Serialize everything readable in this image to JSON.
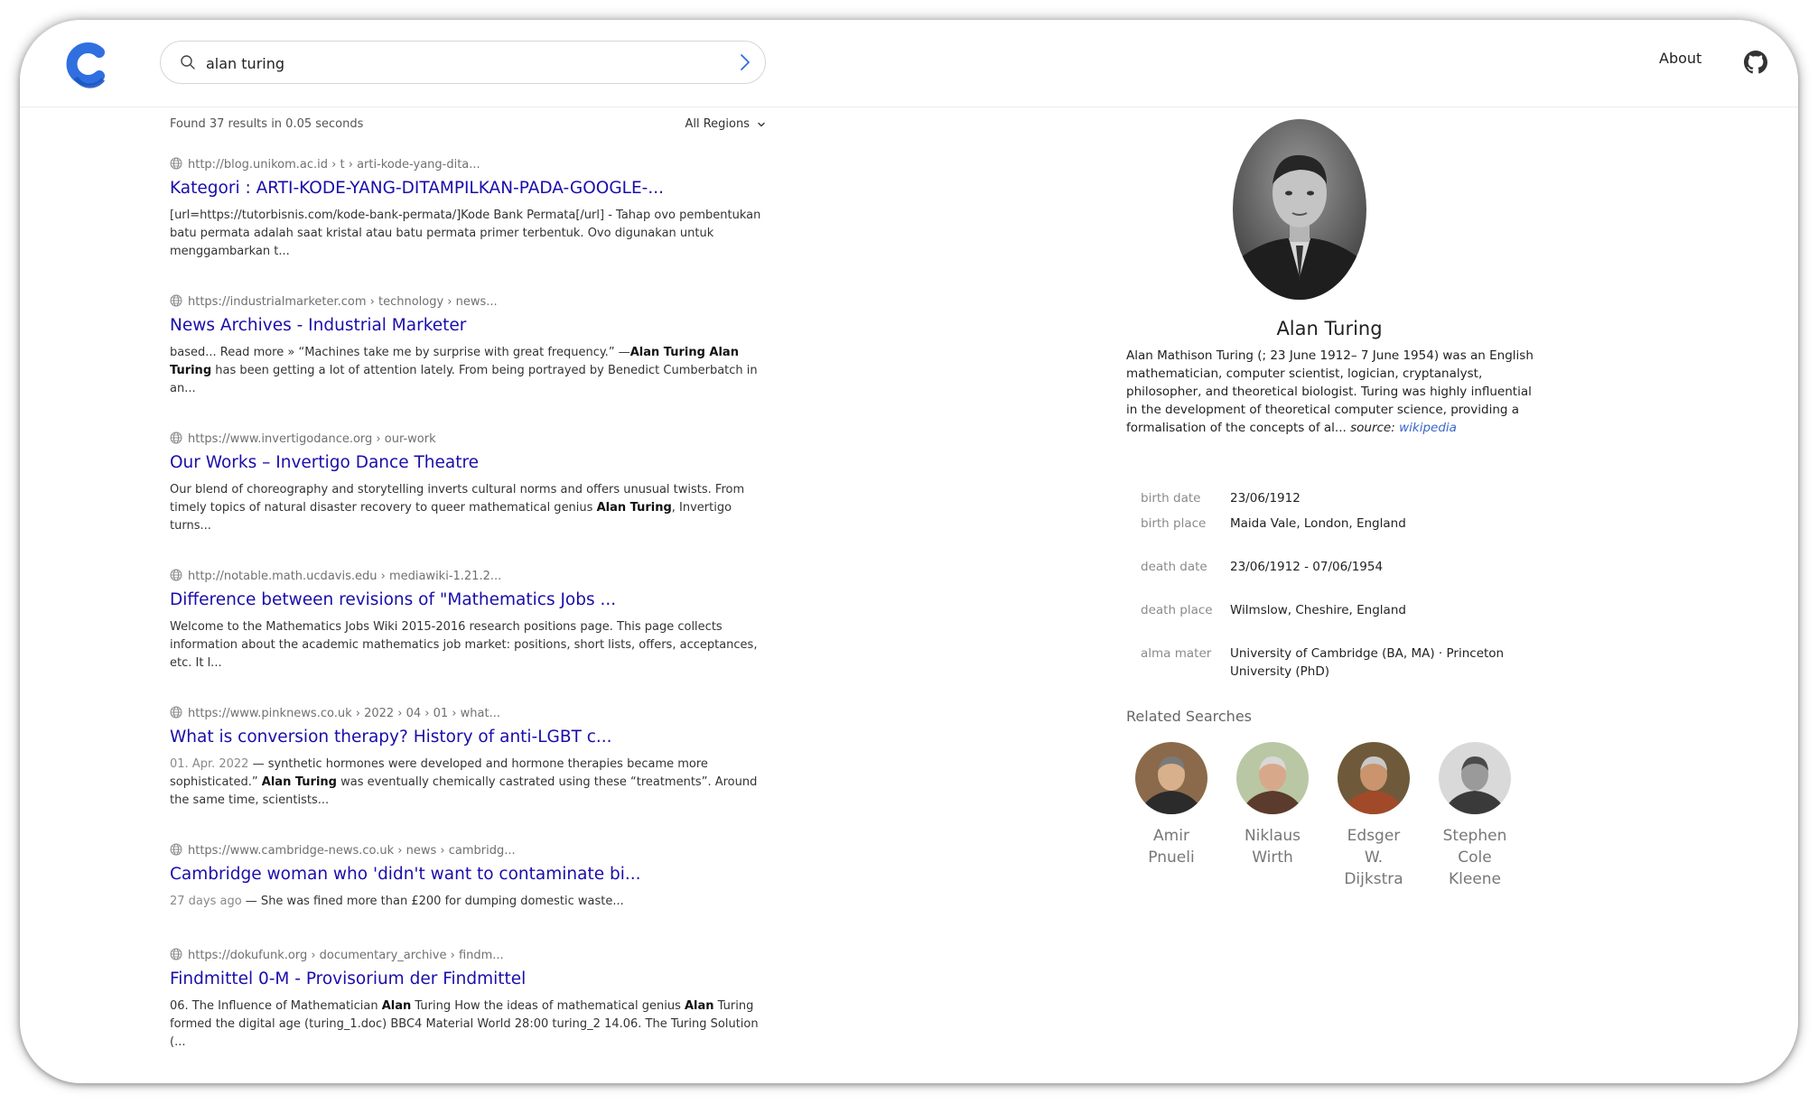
{
  "search": {
    "query": "alan turing"
  },
  "header": {
    "about_label": "About"
  },
  "meta": {
    "results_count": "Found 37 results in 0.05 seconds",
    "region": "All Regions"
  },
  "results": [
    {
      "url": "http://blog.unikom.ac.id › t › arti-kode-yang-dita...",
      "title": "Kategori : ARTI-KODE-YANG-DITAMPILKAN-PADA-GOOGLE-...",
      "snippet_html": "[url=https://tutorbisnis.com/kode-bank-permata/]Kode Bank Permata[/url] - Tahap ovo pembentukan batu permata adalah saat kristal atau batu permata primer terbentuk. Ovo digunakan untuk menggambarkan t..."
    },
    {
      "url": "https://industrialmarketer.com › technology › news...",
      "title": "News Archives - Industrial Marketer",
      "snippet_html": "based... Read more » “Machines take me by surprise with great frequency.” —<b>Alan Turing Alan Turing</b> has been getting a lot of attention lately. From being portrayed by Benedict Cumberbatch in an..."
    },
    {
      "url": "https://www.invertigodance.org › our-work",
      "title": "Our Works – Invertigo Dance Theatre",
      "snippet_html": "Our blend of choreography and storytelling inverts cultural norms and offers unusual twists. From timely topics of natural disaster recovery to queer mathematical genius <b>Alan Turing</b>, Invertigo turns..."
    },
    {
      "url": "http://notable.math.ucdavis.edu › mediawiki-1.21.2...",
      "title": "Difference between revisions of \"Mathematics Jobs ...",
      "snippet_html": "Welcome to the Mathematics Jobs Wiki 2015-2016 research positions page. This page collects information about the academic mathematics job market: positions, short lists, offers, acceptances, etc. It l..."
    },
    {
      "url": "https://www.pinknews.co.uk › 2022 › 04 › 01 › what...",
      "title": "What is conversion therapy? History of anti-LGBT c...",
      "snippet_html": "<span class=\"date\">01. Apr. 2022</span> — synthetic hormones were developed and hormone therapies became more sophisticated.” <b>Alan Turing</b> was eventually chemically castrated using these “treatments”. Around the same time, scientists..."
    },
    {
      "url": "https://www.cambridge-news.co.uk › news › cambridg...",
      "title": "Cambridge woman who 'didn't want to contaminate bi...",
      "snippet_html": "<span class=\"date\">27 days ago</span> — She was fined more than £200 for dumping domestic waste..."
    },
    {
      "url": "https://dokufunk.org › documentary_archive › findm...",
      "title": "Findmittel 0-M - Provisorium der Findmittel",
      "snippet_html": "06. The Influence of Mathematician <b>Alan</b> Turing How the ideas of mathematical genius <b>Alan</b> Turing formed the digital age (turing_1.doc) BBC4 Material World 28:00 turing_2 14.06. The Turing Solution (..."
    }
  ],
  "knowledge_panel": {
    "name": "Alan Turing",
    "description": "Alan Mathison Turing (; 23 June 1912– 7 June 1954) was an English mathematician, computer scientist, logician, cryptanalyst, philosopher, and theoretical biologist. Turing was highly influential in the development of theoretical computer science, providing a formalisation of the concepts of al...",
    "source_label": "source:",
    "source_link": "wikipedia",
    "facts": [
      {
        "key": "birth date",
        "value": "23/06/1912"
      },
      {
        "key": "birth place",
        "value": "Maida Vale, London, England"
      },
      {
        "key": "death date",
        "value": "23/06/1912 - 07/06/1954"
      },
      {
        "key": "death place",
        "value": "Wilmslow, Cheshire, England"
      },
      {
        "key": "alma mater",
        "value": "University of Cambridge (BA, MA) · Princeton University (PhD)"
      }
    ],
    "related_title": "Related Searches",
    "related": [
      {
        "name": "Amir Pnueli"
      },
      {
        "name": "Niklaus Wirth"
      },
      {
        "name": "Edsger W. Dijkstra"
      },
      {
        "name": "Stephen Cole Kleene"
      }
    ]
  },
  "colors": {
    "link": "#1a0dab",
    "accent": "#2f6fe0",
    "source_link": "#3867c8"
  }
}
